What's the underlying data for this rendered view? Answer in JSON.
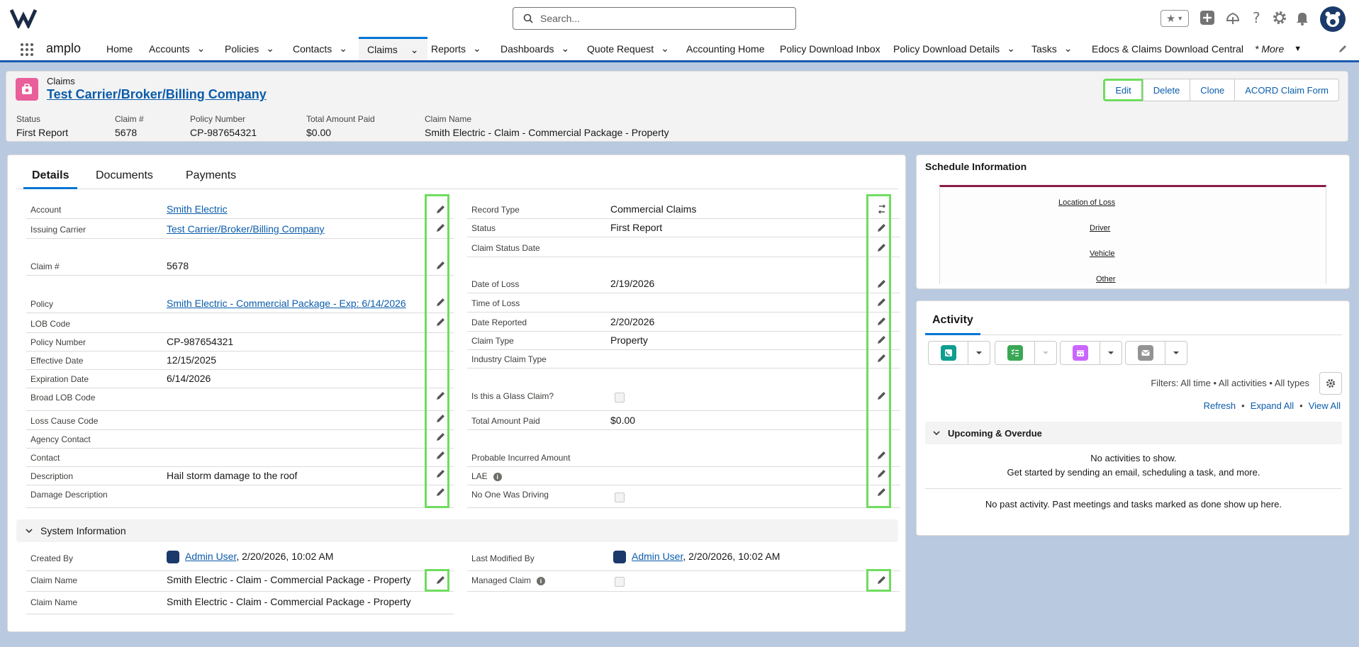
{
  "header": {
    "search_placeholder": "Search..."
  },
  "nav": {
    "app_name": "amplo",
    "items": [
      {
        "label": "Home"
      },
      {
        "label": "Accounts"
      },
      {
        "label": "Policies"
      },
      {
        "label": "Contacts"
      },
      {
        "label": "Claims"
      },
      {
        "label": "Reports"
      },
      {
        "label": "Dashboards"
      },
      {
        "label": "Quote Request"
      },
      {
        "label": "Accounting Home"
      },
      {
        "label": "Policy Download Inbox"
      },
      {
        "label": "Policy Download Details"
      },
      {
        "label": "Tasks"
      },
      {
        "label": "Edocs & Claims Download Central"
      },
      {
        "label": "* More"
      }
    ]
  },
  "record": {
    "type_label": "Claims",
    "title": "Test Carrier/Broker/Billing Company",
    "actions": [
      "Edit",
      "Delete",
      "Clone",
      "ACORD Claim Form"
    ],
    "highlights": [
      {
        "label": "Status",
        "value": "First Report"
      },
      {
        "label": "Claim #",
        "value": "5678"
      },
      {
        "label": "Policy Number",
        "value": "CP-987654321"
      },
      {
        "label": "Total Amount Paid",
        "value": "$0.00"
      },
      {
        "label": "Claim Name",
        "value": "Smith Electric - Claim - Commercial Package - Property"
      }
    ]
  },
  "tabs": [
    "Details",
    "Documents",
    "Payments"
  ],
  "details_left": [
    {
      "label": "Account",
      "value": "Smith Electric"
    },
    {
      "label": "Issuing Carrier",
      "value": "Test Carrier/Broker/Billing Company"
    },
    {
      "label": "Claim #",
      "value": "5678"
    },
    {
      "label": "Policy",
      "value": "Smith Electric - Commercial Package - Exp: 6/14/2026"
    },
    {
      "label": "LOB Code",
      "value": ""
    },
    {
      "label": "Policy Number",
      "value": "CP-987654321"
    },
    {
      "label": "Effective Date",
      "value": "12/15/2025"
    },
    {
      "label": "Expiration Date",
      "value": "6/14/2026"
    },
    {
      "label": "Broad LOB Code",
      "value": ""
    },
    {
      "label": "Loss Cause Code",
      "value": ""
    },
    {
      "label": "Agency Contact",
      "value": ""
    },
    {
      "label": "Contact",
      "value": ""
    },
    {
      "label": "Description",
      "value": "Hail storm damage to the roof"
    },
    {
      "label": "Damage Description",
      "value": ""
    }
  ],
  "details_right": [
    {
      "label": "Record Type",
      "value": "Commercial Claims"
    },
    {
      "label": "Status",
      "value": "First Report"
    },
    {
      "label": "Claim Status Date",
      "value": ""
    },
    {
      "label": "Date of Loss",
      "value": "2/19/2026"
    },
    {
      "label": "Time of Loss",
      "value": ""
    },
    {
      "label": "Date Reported",
      "value": "2/20/2026"
    },
    {
      "label": "Claim Type",
      "value": "Property"
    },
    {
      "label": "Industry Claim Type",
      "value": ""
    },
    {
      "label": "Is this a Glass Claim?",
      "value": ""
    },
    {
      "label": "Total Amount Paid",
      "value": "$0.00"
    },
    {
      "label": "Probable Incurred Amount",
      "value": ""
    },
    {
      "label": "LAE",
      "value": ""
    },
    {
      "label": "No One Was Driving",
      "value": ""
    }
  ],
  "system_info": {
    "title": "System Information",
    "created_by_label": "Created By",
    "created_by_user": "Admin User",
    "created_by_date": ", 2/20/2026, 10:02 AM",
    "modified_by_label": "Last Modified By",
    "modified_by_user": "Admin User",
    "modified_by_date": ", 2/20/2026, 10:02 AM",
    "claim_name_label": "Claim Name",
    "claim_name_value": "Smith Electric - Claim - Commercial Package - Property",
    "managed_claim_label": "Managed Claim",
    "claim_name2_label": "Claim Name",
    "claim_name2_value": "Smith Electric - Claim - Commercial Package - Property"
  },
  "schedule": {
    "title": "Schedule Information",
    "links": [
      "Location of Loss",
      "Driver",
      "Vehicle",
      "Other"
    ]
  },
  "activity": {
    "title": "Activity",
    "filters": "Filters: All time • All activities • All types",
    "refresh": "Refresh",
    "expand_all": "Expand All",
    "view_all": "View All",
    "upcoming": "Upcoming & Overdue",
    "no_activities": "No activities to show.",
    "get_started": "Get started by sending an email, scheduling a task, and more.",
    "no_past": "No past activity. Past meetings and tasks marked as done show up here.",
    "colors": {
      "call": "#0e9e8f",
      "task": "#3ba755",
      "event": "#cb65ff",
      "email": "#939393"
    }
  }
}
